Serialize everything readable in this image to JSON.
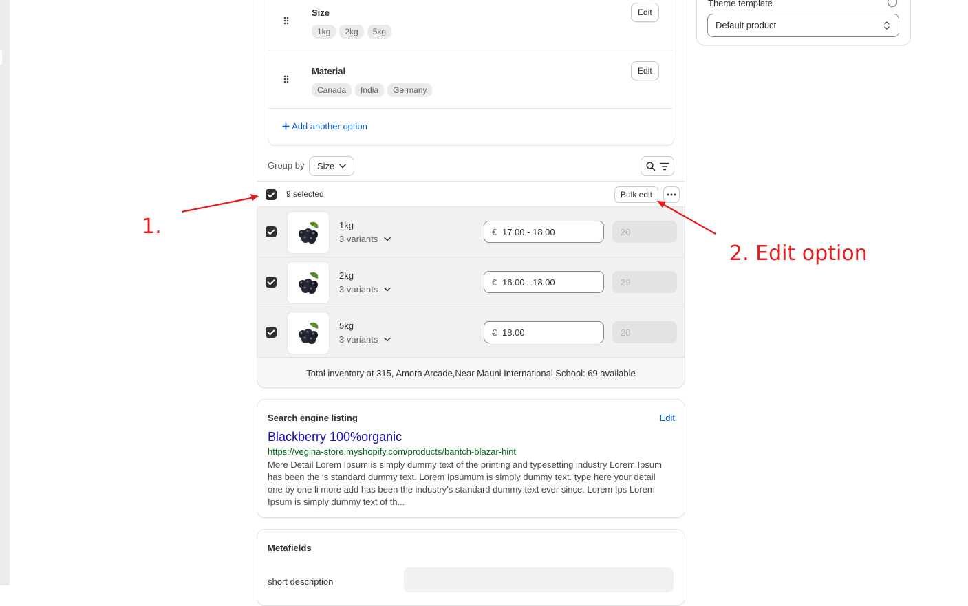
{
  "sidebar_card": {
    "theme_label": "Theme template",
    "theme_value": "Default product"
  },
  "options": [
    {
      "name": "Size",
      "values": [
        "1kg",
        "2kg",
        "5kg"
      ],
      "edit_label": "Edit"
    },
    {
      "name": "Material",
      "values": [
        "Canada",
        "India",
        "Germany"
      ],
      "edit_label": "Edit"
    }
  ],
  "add_option_label": "Add another option",
  "group_by": {
    "label": "Group by",
    "value": "Size"
  },
  "selection": {
    "count_text": "9 selected",
    "bulk_edit_label": "Bulk edit"
  },
  "variants": [
    {
      "name": "1kg",
      "sub": "3 variants",
      "currency": "€",
      "price": "17.00 - 18.00",
      "quantity": "20"
    },
    {
      "name": "2kg",
      "sub": "3 variants",
      "currency": "€",
      "price": "16.00 - 18.00",
      "quantity": "29"
    },
    {
      "name": "5kg",
      "sub": "3 variants",
      "currency": "€",
      "price": "18.00",
      "quantity": "20"
    }
  ],
  "inventory_total": "Total inventory at 315, Amora Arcade,Near Mauni International School: 69 available",
  "seo": {
    "heading": "Search engine listing",
    "edit_label": "Edit",
    "title": "Blackberry 100%organic",
    "url": "https://vegina-store.myshopify.com/products/bantch-blazar-hint",
    "description": "More Detail Lorem Ipsum is simply dummy text of the printing and typesetting industry Lorem Ipsum has been the ‘s standard dummy text. Lorem Ipsumum is simply dummy text. type here your detail one by one li more add has been the industry’s standard dummy text ever since. Lorem Ips Lorem Ipsum is simply dummy text of th..."
  },
  "metafields": {
    "heading": "Metafields",
    "first_label": "short description"
  },
  "annotations": {
    "step1": "1.",
    "step2": "2. Edit option"
  },
  "colors": {
    "accent_link": "#005bd3",
    "seo_title": "#1a0dab",
    "seo_url": "#006621",
    "annotation": "#e81c1c",
    "checkbox": "#303030"
  },
  "icons": [
    "drag-handle-icon",
    "plus-icon",
    "chevron-down-icon",
    "search-icon",
    "filter-icon",
    "more-horizontal-icon",
    "select-arrows-icon",
    "help-circle-icon"
  ]
}
